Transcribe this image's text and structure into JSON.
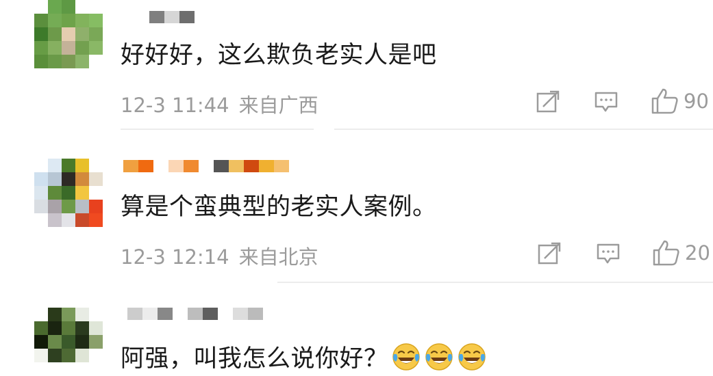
{
  "comments": [
    {
      "text": "好好好，这么欺负老实人是吧",
      "date": "12-3 11:44",
      "location": "来自广西",
      "likes": "90",
      "avatar_colors": [
        "#ffffff",
        "#6aa84f",
        "#5e9944",
        "#ffffff",
        "#ffffff",
        "#5b8f3d",
        "#75ac55",
        "#6ea34a",
        "#82b35c",
        "#86bd63",
        "#3d7a2a",
        "#6d9a4a",
        "#e5cdb0",
        "#8fb06b",
        "#7aa857",
        "#679c45",
        "#86b060",
        "#c4b298",
        "#73a04f",
        "#8ab866",
        "#5a8f3a",
        "#6a9a48",
        "#7a9a52",
        "#8cb46a",
        "#ffffff"
      ],
      "username_colors": [
        "#7f7f7f",
        "#d6d6d6",
        "#6e6e6e"
      ]
    },
    {
      "text": "算是个蛮典型的老实人案例。",
      "date": "12-3 12:14",
      "location": "来自北京",
      "likes": "20",
      "avatar_colors": [
        "#ffffff",
        "#dde9f3",
        "#4a7a2a",
        "#e8c02a",
        "#ffffff",
        "#cfe0ef",
        "#b7c6d4",
        "#2e2a25",
        "#d28a3c",
        "#e8dfd0",
        "#dbe6ef",
        "#5e8a3a",
        "#3a6a28",
        "#f2c640",
        "#ffffff",
        "#d9dde2",
        "#a9a2a8",
        "#6e9a48",
        "#b8bec6",
        "#e8411e",
        "#ffffff",
        "#c9c3cb",
        "#e3e3e8",
        "#c94a2a",
        "#f04a20"
      ],
      "username_colors": [
        "#f0a040",
        "#f06a10",
        "#ffffff",
        "#fbd6b5",
        "#f08a30",
        "#ffffff",
        "#555555",
        "#f0c060",
        "#d04a10",
        "#f0b030",
        "#f5c070"
      ]
    },
    {
      "text": "阿强，叫我怎么说你好？",
      "emoji_count": 3,
      "avatar_colors": [
        "#ffffff",
        "#2a3a1a",
        "#7a9a5a",
        "#e8ece4",
        "#ffffff",
        "#4a6a2e",
        "#1a2410",
        "#5a7a3a",
        "#2a3a1e",
        "#dfe6d8",
        "#111a08",
        "#6a8a4a",
        "#3a5a2a",
        "#1e2a14",
        "#8aa06a",
        "#f2f4ee",
        "#2e4020",
        "#4e6a34",
        "#dfe5d6",
        "#ffffff",
        "#ffffff",
        "#ffffff",
        "#ffffff",
        "#ffffff",
        "#ffffff"
      ],
      "username_colors": [
        "#cccccc",
        "#ececec",
        "#888888",
        "#ffffff",
        "#bdbdbd",
        "#5e5e5e",
        "#ffffff",
        "#dddddd",
        "#bbbbbb"
      ]
    }
  ],
  "actions": {
    "share_icon": "share-icon",
    "reply_icon": "comment-icon",
    "like_icon": "thumbs-up-icon"
  },
  "theme": {
    "text": "#1a1a1a",
    "meta": "#9b9b9b",
    "divider": "#ececec",
    "emoji_yellow": "#f7c948"
  }
}
